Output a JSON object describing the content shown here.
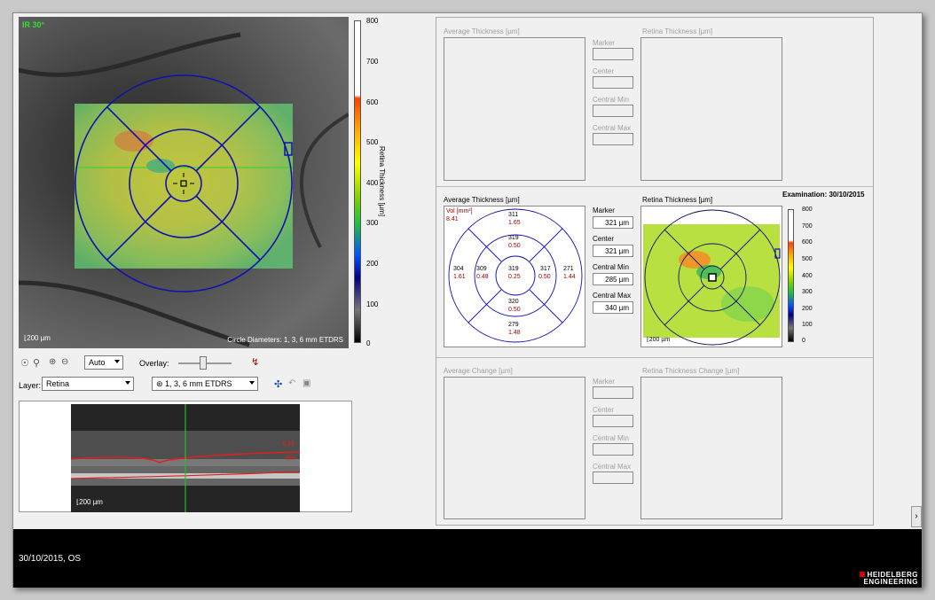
{
  "fundus": {
    "top_left_label": "IR 30°",
    "scale_label": "200 µm",
    "circle_label": "Circle Diameters: 1, 3, 6 mm ETDRS"
  },
  "colorbar": {
    "title": "Retina Thickness [µm]",
    "ticks": [
      "800",
      "700",
      "600",
      "500",
      "400",
      "300",
      "200",
      "100",
      "0"
    ]
  },
  "toolbar": {
    "zoom_value": "Auto",
    "overlay_label": "Overlay:",
    "layer_label": "Layer:",
    "layer_value": "Retina",
    "grid_value": "1, 3, 6 mm ETDRS"
  },
  "oct": {
    "ilm_label": "ILM",
    "bm_label": "BM",
    "scale_label": "200 µm"
  },
  "top_panel": {
    "avg_title": "Average Thickness [µm]",
    "retina_title": "Retina Thickness [µm]",
    "marker": "Marker",
    "center": "Center",
    "central_min": "Central Min",
    "central_max": "Central Max"
  },
  "mid_panel": {
    "avg_title": "Average Thickness [µm]",
    "retina_title": "Retina Thickness [µm]",
    "exam": "Examination: 30/10/2015",
    "vol_label": "Vol [mm³]",
    "vol_value": "8.41",
    "sectors": {
      "center": {
        "t": "319",
        "v": "0.25"
      },
      "in_sup": {
        "t": "319",
        "v": "0.50"
      },
      "in_inf": {
        "t": "320",
        "v": "0.50"
      },
      "in_left": {
        "t": "309",
        "v": "0.48"
      },
      "in_right": {
        "t": "317",
        "v": "0.50"
      },
      "out_sup": {
        "t": "311",
        "v": "1.65"
      },
      "out_inf": {
        "t": "279",
        "v": "1.48"
      },
      "out_left": {
        "t": "304",
        "v": "1.61"
      },
      "out_right": {
        "t": "271",
        "v": "1.44"
      }
    },
    "marker": "Marker",
    "marker_value": "321 µm",
    "center": "Center",
    "center_value": "321 µm",
    "central_min": "Central Min",
    "central_min_value": "285 µm",
    "central_max": "Central Max",
    "central_max_value": "340 µm",
    "map_scale": "200 µm",
    "map_ticks": [
      "800",
      "700",
      "600",
      "500",
      "400",
      "300",
      "200",
      "100",
      "0"
    ]
  },
  "bottom_panel": {
    "avg_title": "Average Change [µm]",
    "retina_title": "Retina Thickness Change [µm]",
    "marker": "Marker",
    "center": "Center",
    "central_min": "Central Min",
    "central_max": "Central Max"
  },
  "footer": {
    "date_eye": "30/10/2015, OS",
    "brand_line1": "HEIDELBERG",
    "brand_line2": "ENGINEERING"
  },
  "colors": {
    "grid": "#1010b0",
    "values_red": "#a00000",
    "footer_bg": "#000000"
  }
}
